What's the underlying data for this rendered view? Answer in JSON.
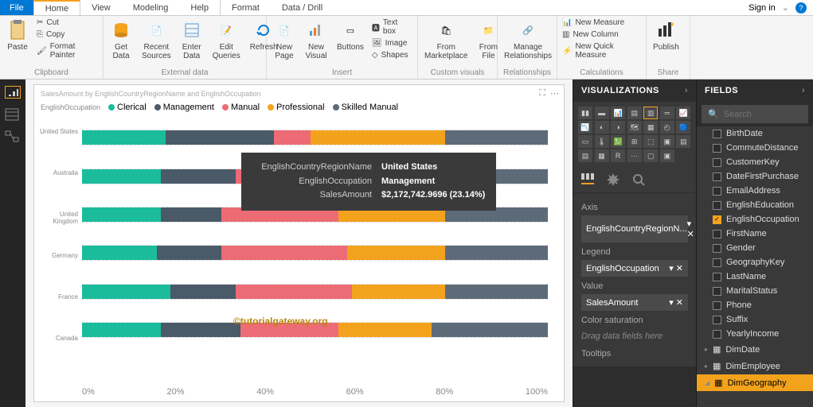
{
  "tabs": {
    "file": "File",
    "home": "Home",
    "view": "View",
    "modeling": "Modeling",
    "help": "Help",
    "format": "Format",
    "data_drill": "Data / Drill"
  },
  "top_right": {
    "sign_in": "Sign in"
  },
  "ribbon": {
    "clipboard": {
      "paste": "Paste",
      "cut": "Cut",
      "copy": "Copy",
      "format_painter": "Format Painter",
      "label": "Clipboard"
    },
    "external": {
      "get_data": "Get\nData",
      "recent": "Recent\nSources",
      "enter": "Enter\nData",
      "edit": "Edit\nQueries",
      "refresh": "Refresh",
      "label": "External data"
    },
    "insert": {
      "new_page": "New\nPage",
      "new_visual": "New\nVisual",
      "buttons": "Buttons",
      "textbox": "Text box",
      "image": "Image",
      "shapes": "Shapes",
      "label": "Insert"
    },
    "custom": {
      "marketplace": "From\nMarketplace",
      "file": "From\nFile",
      "label": "Custom visuals"
    },
    "relationships": {
      "manage": "Manage\nRelationships",
      "label": "Relationships"
    },
    "calculations": {
      "measure": "New Measure",
      "column": "New Column",
      "quick": "New Quick Measure",
      "label": "Calculations"
    },
    "share": {
      "publish": "Publish",
      "label": "Share"
    }
  },
  "viz": {
    "title": "SalesAmount by EnglishCountryRegionName and EnglishOccupation",
    "legend_label": "EnglishOccupation",
    "legend": [
      "Clerical",
      "Management",
      "Manual",
      "Professional",
      "Skilled Manual"
    ]
  },
  "chart_data": {
    "type": "bar",
    "orientation": "horizontal-stacked-100",
    "title": "SalesAmount by EnglishCountryRegionName and EnglishOccupation",
    "xlabel": "",
    "ylabel": "",
    "xlim": [
      0,
      100
    ],
    "x_ticks": [
      "0%",
      "20%",
      "40%",
      "60%",
      "80%",
      "100%"
    ],
    "categories": [
      "United States",
      "Australia",
      "United Kingdom",
      "Germany",
      "France",
      "Canada"
    ],
    "series": [
      {
        "name": "Clerical",
        "color": "#1abc9c",
        "values": [
          18,
          17,
          17,
          16,
          19,
          17
        ]
      },
      {
        "name": "Management",
        "color": "#4a5a68",
        "values": [
          23.14,
          16,
          13,
          14,
          14,
          17
        ]
      },
      {
        "name": "Manual",
        "color": "#ed6b75",
        "values": [
          8,
          17,
          25,
          27,
          25,
          21
        ]
      },
      {
        "name": "Professional",
        "color": "#f3a21d",
        "values": [
          28.86,
          22,
          23,
          21,
          20,
          20
        ]
      },
      {
        "name": "Skilled Manual",
        "color": "#5d6b79",
        "values": [
          22,
          28,
          22,
          22,
          22,
          25
        ]
      }
    ]
  },
  "tooltip": {
    "rows": [
      {
        "label": "EnglishCountryRegionName",
        "value": "United States"
      },
      {
        "label": "EnglishOccupation",
        "value": "Management"
      },
      {
        "label": "SalesAmount",
        "value": "$2,172,742.9696 (23.14%)"
      }
    ]
  },
  "watermark": "©tutorialgateway.org",
  "panels": {
    "viz_title": "VISUALIZATIONS",
    "fields_title": "FIELDS",
    "search_placeholder": "Search",
    "wells": {
      "axis": {
        "label": "Axis",
        "value": "EnglishCountryRegionN..."
      },
      "legend": {
        "label": "Legend",
        "value": "EnglishOccupation"
      },
      "value": {
        "label": "Value",
        "value": "SalesAmount"
      },
      "color_sat": {
        "label": "Color saturation",
        "placeholder": "Drag data fields here"
      },
      "tooltips": {
        "label": "Tooltips"
      }
    }
  },
  "fields": {
    "columns": [
      "BirthDate",
      "CommuteDistance",
      "CustomerKey",
      "DateFirstPurchase",
      "EmailAddress",
      "EnglishEducation",
      "EnglishOccupation",
      "FirstName",
      "Gender",
      "GeographyKey",
      "LastName",
      "MaritalStatus",
      "Phone",
      "Suffix",
      "YearlyIncome"
    ],
    "checked": [
      "EnglishOccupation"
    ],
    "tables": [
      "DimDate",
      "DimEmployee",
      "DimGeography"
    ]
  }
}
